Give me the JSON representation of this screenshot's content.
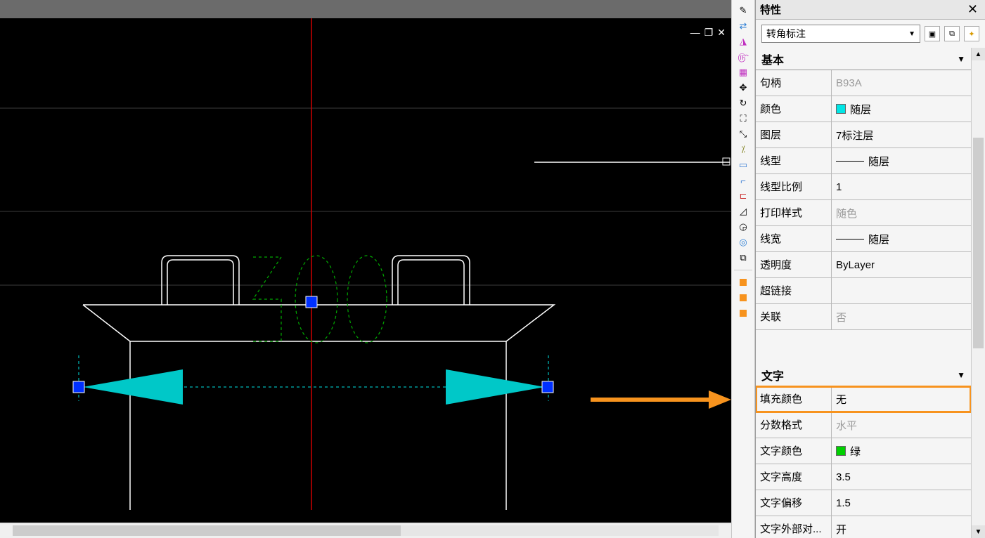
{
  "panel": {
    "title": "特性",
    "selector": "转角标注"
  },
  "canvas": {
    "dimText": "500"
  },
  "sections": {
    "basic": {
      "title": "基本",
      "rows": {
        "handle": {
          "label": "句柄",
          "value": "B93A",
          "dim": true
        },
        "color": {
          "label": "颜色",
          "value": "随层",
          "swatch": "#00e5e5"
        },
        "layer": {
          "label": "图层",
          "value": "7标注层"
        },
        "linetype": {
          "label": "线型",
          "value": "随层",
          "line": true
        },
        "ltscale": {
          "label": "线型比例",
          "value": "1"
        },
        "plotstyle": {
          "label": "打印样式",
          "value": "随色",
          "dim": true
        },
        "lineweight": {
          "label": "线宽",
          "value": "随层",
          "line": true
        },
        "transparency": {
          "label": "透明度",
          "value": "ByLayer"
        },
        "hyperlink": {
          "label": "超链接",
          "value": ""
        },
        "assoc": {
          "label": "关联",
          "value": "否",
          "dim": true
        }
      }
    },
    "text": {
      "title": "文字",
      "rows": {
        "fillcolor": {
          "label": "填充颜色",
          "value": "无",
          "highlight": true
        },
        "fracformat": {
          "label": "分数格式",
          "value": "水平",
          "dim": true
        },
        "textcolor": {
          "label": "文字颜色",
          "value": "绿",
          "swatch": "#00d000"
        },
        "textheight": {
          "label": "文字高度",
          "value": "3.5"
        },
        "textoffset": {
          "label": "文字偏移",
          "value": "1.5"
        },
        "textoutside": {
          "label": "文字外部对...",
          "value": "开"
        }
      }
    }
  }
}
